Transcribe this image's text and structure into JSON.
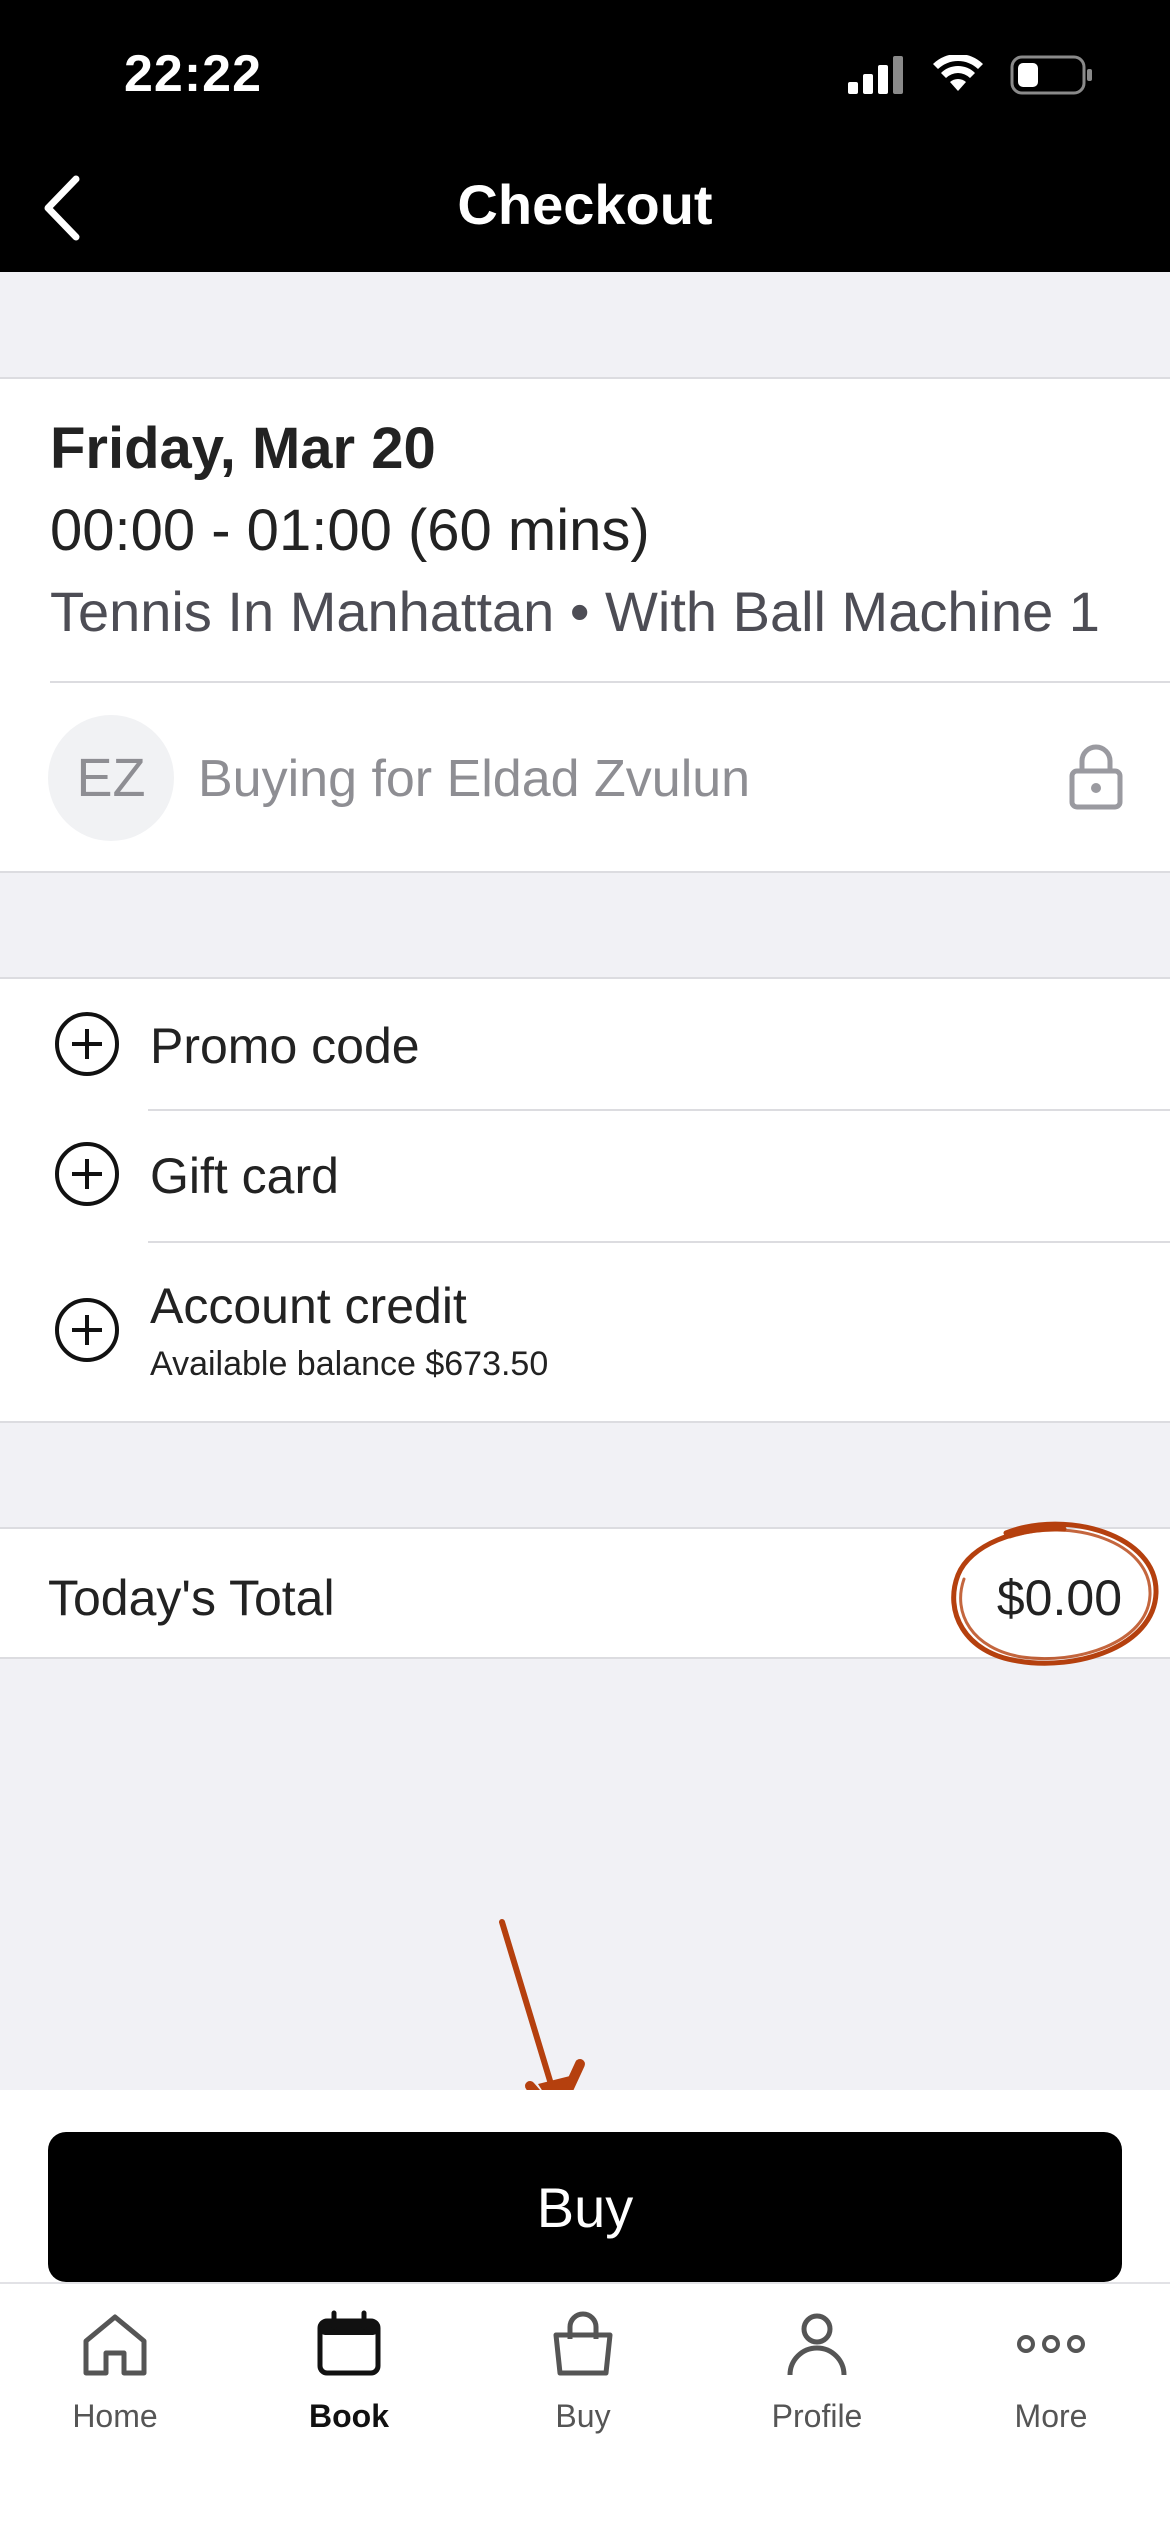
{
  "status_bar": {
    "time": "22:22"
  },
  "header": {
    "title": "Checkout"
  },
  "booking": {
    "date": "Friday, Mar 20",
    "time": "00:00 - 01:00 (60 mins)",
    "venue": "Tennis In Manhattan • With Ball Machine 1",
    "avatar_initials": "EZ",
    "buying_for": "Buying for Eldad Zvulun"
  },
  "options": [
    {
      "label": "Promo code",
      "icon": "plus-circle-icon"
    },
    {
      "label": "Gift card",
      "icon": "plus-circle-icon"
    },
    {
      "label": "Account credit",
      "sub": "Available balance $673.50",
      "icon": "plus-circle-icon"
    }
  ],
  "total": {
    "label": "Today's Total",
    "value": "$0.00"
  },
  "buy_button": {
    "label": "Buy"
  },
  "tabbar": {
    "items": [
      {
        "label": "Home",
        "icon": "home-icon",
        "active": false
      },
      {
        "label": "Book",
        "icon": "calendar-icon",
        "active": true
      },
      {
        "label": "Buy",
        "icon": "shopping-bag-icon",
        "active": false
      },
      {
        "label": "Profile",
        "icon": "person-icon",
        "active": false
      },
      {
        "label": "More",
        "icon": "more-dots-icon",
        "active": false
      }
    ]
  },
  "colors": {
    "annotation": "#b5400e",
    "header_bg": "#000000",
    "page_bg": "#f1f1f5"
  }
}
